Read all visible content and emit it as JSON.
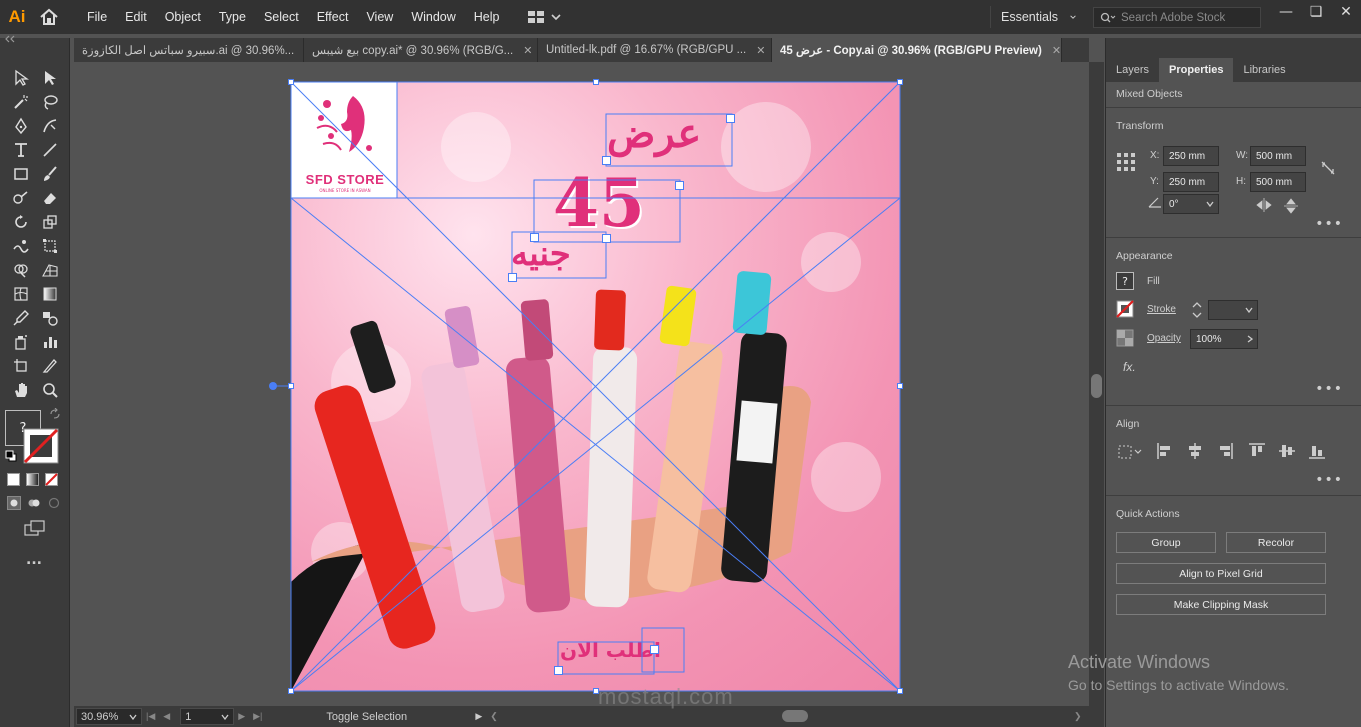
{
  "app": {
    "logo": "Ai",
    "menus": [
      "File",
      "Edit",
      "Object",
      "Type",
      "Select",
      "Effect",
      "View",
      "Window",
      "Help"
    ],
    "workspace": "Essentials",
    "search_placeholder": "Search Adobe Stock"
  },
  "tabs": [
    {
      "label": "سبيرو سباتس اصل الكازوزة.ai @ 30.96%...",
      "active": false
    },
    {
      "label": "بيع شيبس copy.ai* @ 30.96% (RGB/G...",
      "active": false
    },
    {
      "label": "Untitled-lk.pdf @ 16.67% (RGB/GPU ...",
      "active": false
    },
    {
      "label": "45 عرض - Copy.ai @ 30.96% (RGB/GPU Preview)",
      "active": true
    }
  ],
  "artboard": {
    "logo_text": "SFD STORE",
    "logo_subtext": "ONLINE STORE IN ASWAN",
    "offer_word": "عرض",
    "offer_number": "45",
    "currency_word": "جنيه",
    "order_now": "اطلب الان"
  },
  "toolbar": {
    "fill_stroke_unknown": "?",
    "more": "..."
  },
  "statusbar": {
    "zoom": "30.96%",
    "page": "1",
    "toggle_label": "Toggle Selection"
  },
  "panel": {
    "tabs": [
      "Layers",
      "Properties",
      "Libraries"
    ],
    "active_tab": "Properties",
    "object_type": "Mixed Objects",
    "transform": {
      "title": "Transform",
      "x_label": "X:",
      "x": "250 mm",
      "y_label": "Y:",
      "y": "250 mm",
      "w_label": "W:",
      "w": "500 mm",
      "h_label": "H:",
      "h": "500 mm",
      "angle": "0°"
    },
    "appearance": {
      "title": "Appearance",
      "fill": "Fill",
      "fill_symbol": "?",
      "stroke": "Stroke",
      "opacity": "Opacity",
      "opacity_value": "100%",
      "fx": "fx."
    },
    "align": {
      "title": "Align"
    },
    "quick_actions": {
      "title": "Quick Actions",
      "group": "Group",
      "recolor": "Recolor",
      "align_pixel": "Align to Pixel Grid",
      "clipping_mask": "Make Clipping Mask"
    },
    "more": "•••"
  },
  "system": {
    "activate_title": "Activate Windows",
    "activate_sub": "Go to Settings to activate Windows.",
    "watermark": "mostaql.com"
  },
  "colors": {
    "accent": "#ff9a00",
    "selection": "#4a7ef5",
    "brand_pink": "#e0307a"
  }
}
